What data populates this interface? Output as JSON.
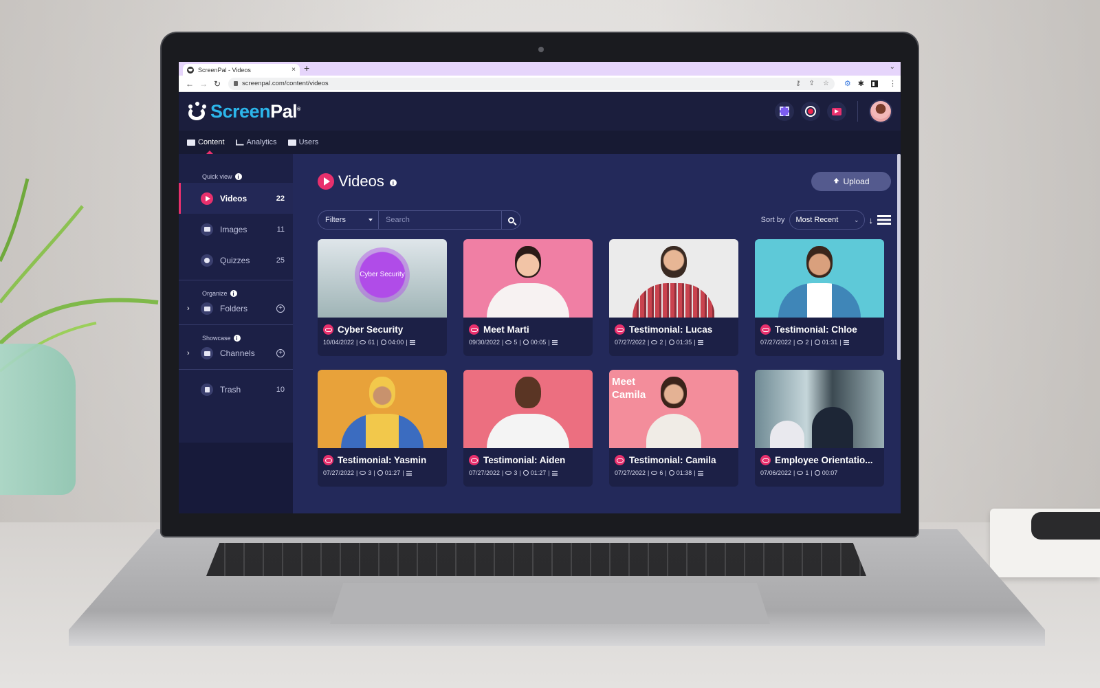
{
  "browser": {
    "tab_title": "ScreenPal - Videos",
    "tab_close": "×",
    "new_tab": "+",
    "tab_menu": "⌄",
    "url": "screenpal.com/content/videos",
    "nav": {
      "back": "←",
      "forward": "→",
      "reload": "↻"
    },
    "omni_icons": [
      "⚷",
      "⇪",
      "☆"
    ],
    "extensions": [
      "⚙",
      "✱"
    ],
    "menu": "⋮"
  },
  "app": {
    "brand_screen": "Screen",
    "brand_pal": "Pal",
    "brand_reg": "®",
    "nav_tabs": [
      {
        "label": "Content",
        "icon": "content-icon",
        "active": true
      },
      {
        "label": "Analytics",
        "icon": "analytics-icon",
        "active": false
      },
      {
        "label": "Users",
        "icon": "users-icon",
        "active": false
      }
    ],
    "accent": "#e8306d",
    "logo_color": "#2cb5ea"
  },
  "sidebar": {
    "quick_view_label": "Quick view",
    "quick_view": [
      {
        "label": "Videos",
        "count": "22",
        "active": true
      },
      {
        "label": "Images",
        "count": "11",
        "active": false
      },
      {
        "label": "Quizzes",
        "count": "25",
        "active": false
      }
    ],
    "organize_label": "Organize",
    "folders_label": "Folders",
    "showcase_label": "Showcase",
    "channels_label": "Channels",
    "trash_label": "Trash",
    "trash_count": "10",
    "info_glyph": "i",
    "chevron_glyph": "›",
    "plus_glyph": "+"
  },
  "main": {
    "title": "Videos",
    "upload_label": "Upload",
    "filters_label": "Filters",
    "search_placeholder": "Search",
    "sort_by_label": "Sort by",
    "sort_value": "Most Recent",
    "sort_chevron": "⌄",
    "sort_dir_glyph": "↓",
    "videos": [
      {
        "title": "Cyber Security",
        "date": "10/04/2022",
        "views": "61",
        "duration": "04:00",
        "thumb_text": "Cyber Security",
        "has_menu": true
      },
      {
        "title": "Meet Marti",
        "date": "09/30/2022",
        "views": "5",
        "duration": "00:05",
        "has_menu": true
      },
      {
        "title": "Testimonial: Lucas",
        "date": "07/27/2022",
        "views": "2",
        "duration": "01:35",
        "has_menu": true
      },
      {
        "title": "Testimonial: Chloe",
        "date": "07/27/2022",
        "views": "2",
        "duration": "01:31",
        "has_menu": true
      },
      {
        "title": "Testimonial: Yasmin",
        "date": "07/27/2022",
        "views": "3",
        "duration": "01:27",
        "has_menu": true
      },
      {
        "title": "Testimonial: Aiden",
        "date": "07/27/2022",
        "views": "3",
        "duration": "01:27",
        "has_menu": true
      },
      {
        "title": "Testimonial: Camila",
        "date": "07/27/2022",
        "views": "6",
        "duration": "01:38",
        "thumb_text": "Meet Camila",
        "has_menu": true
      },
      {
        "title": "Employee Orientatio...",
        "date": "07/06/2022",
        "views": "1",
        "duration": "00:07",
        "has_menu": false
      }
    ],
    "separator": "|"
  }
}
